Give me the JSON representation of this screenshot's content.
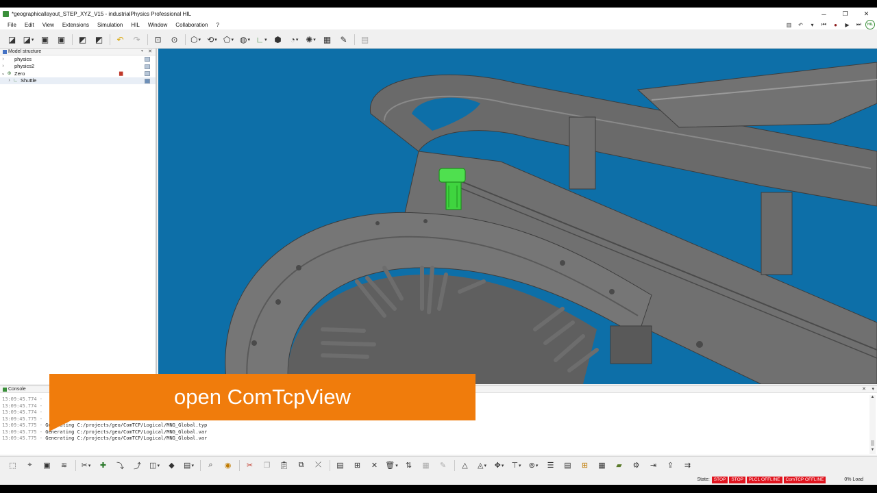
{
  "window": {
    "title": "*geographicallayout_STEP_XYZ_V15 - industrialPhysics Professional HIL",
    "minimize": "─",
    "maximize": "❐",
    "close": "✕"
  },
  "menu": {
    "items": [
      "File",
      "Edit",
      "View",
      "Extensions",
      "Simulation",
      "HIL",
      "Window",
      "Collaboration",
      "?"
    ]
  },
  "model_structure": {
    "title": "Model structure",
    "items": [
      {
        "label": "physics",
        "expanded": false
      },
      {
        "label": "physics2",
        "expanded": false
      },
      {
        "label": "Zero",
        "expanded": true
      },
      {
        "label": "Shuttle",
        "expanded": false
      }
    ]
  },
  "console": {
    "title": "Console",
    "lines": [
      {
        "time": "13:09:45.774 -",
        "text": ""
      },
      {
        "time": "13:09:45.774 -",
        "text": ""
      },
      {
        "time": "13:09:45.774 -",
        "text": ""
      },
      {
        "time": "13:09:45.775 -",
        "text": ""
      },
      {
        "time": "13:09:45.775 -",
        "text": "Generating C:/projects/geo/ComTCP/Logical/MNG_Global.typ"
      },
      {
        "time": "13:09:45.775 -",
        "text": "Generating C:/projects/geo/ComTCP/Logical/MNG_Global.var"
      },
      {
        "time": "13:09:45.775 -",
        "text": "Generating C:/projects/geo/ComTCP/Logical/MNG_Global.var"
      }
    ]
  },
  "overlay": {
    "caption": "open ComTcpView"
  },
  "status": {
    "state_label": "State:",
    "chips": [
      "STOP",
      "STOP",
      "PLC1 OFFLINE",
      "ComTCP OFFLINE"
    ],
    "load": "0% Load"
  },
  "hil_badge": "HIL",
  "colors": {
    "viewport_bg": "#0d6fa8",
    "overlay": "#f07c0c",
    "state_chip": "#e0141e",
    "selection": "#3fdc3f"
  }
}
